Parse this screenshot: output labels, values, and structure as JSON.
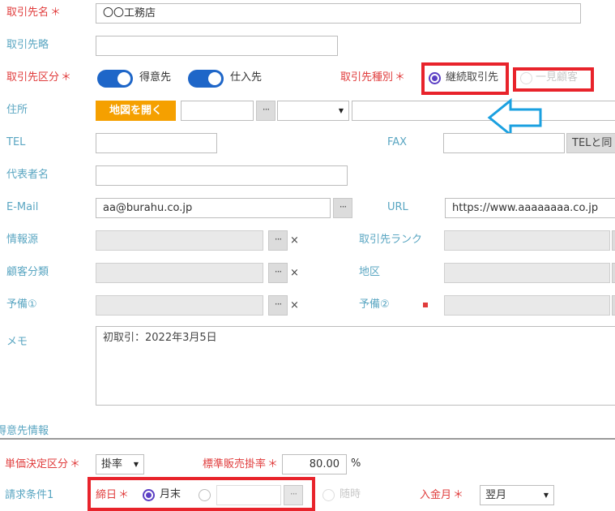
{
  "fields": {
    "name_label": "取引先名",
    "name_value": "〇〇工務店",
    "abbr_label": "取引先略",
    "type_label": "取引先区分",
    "toggle_customer_label": "得意先",
    "toggle_supplier_label": "仕入先",
    "kind_label": "取引先種別",
    "kind_option_continuous": "継続取引先",
    "kind_option_once": "一見顧客",
    "address_label": "住所",
    "open_map_button": "地図を開く",
    "tel_label": "TEL",
    "fax_label": "FAX",
    "same_as_tel_button": "TELと同",
    "rep_label": "代表者名",
    "email_label": "E-Mail",
    "email_value": "aa@burahu.co.jp",
    "url_label": "URL",
    "url_value": "https://www.aaaaaaaa.co.jp",
    "source_label": "情報源",
    "rank_label": "取引先ランク",
    "category_label": "顧客分類",
    "region_label": "地区",
    "spare1_label": "予備①",
    "spare2_label": "予備②",
    "memo_label": "メモ",
    "memo_value": "初取引：2022年3月5日"
  },
  "section": {
    "title": "得意先情報"
  },
  "customer": {
    "price_method_label": "単価決定区分",
    "price_method_value": "掛率",
    "rate_label": "標準販売掛率",
    "rate_value": "80.00",
    "rate_unit": "%",
    "billing_label": "請求条件1",
    "closing_label": "締日",
    "closing_month_end": "月末",
    "closing_asneeded": "随時",
    "payment_month_label": "入金月",
    "payment_month_value": "翌月"
  },
  "symbols": {
    "required": "＊",
    "dots": "···",
    "x": "×",
    "caret": "▼"
  },
  "colors": {
    "accent_blue": "#1e66c8",
    "label_blue": "#5aa6c2",
    "required_red": "#e03c3c",
    "highlight_red": "#e8232b",
    "map_button": "#f5a000",
    "arrow_blue": "#1aa0e0",
    "radio_purple": "#5b3fc4"
  }
}
